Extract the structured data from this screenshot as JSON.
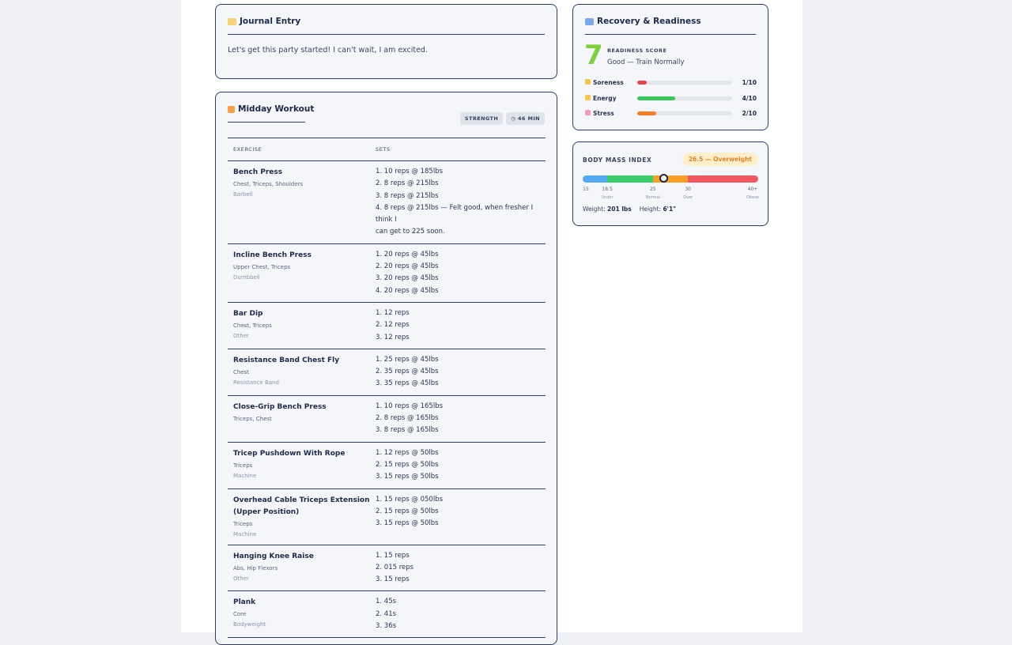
{
  "journal": {
    "title": "Journal Entry",
    "icon": "memo-icon",
    "text": "Let's get this party started! I can't wait, I am excited."
  },
  "workout": {
    "title": "Midday Workout",
    "icon": "weightlifter-icon",
    "type_chip": "STRENGTH",
    "duration_chip": "46 MIN",
    "columns": [
      "EXERCISE",
      "SETS"
    ],
    "exercises": [
      {
        "name": "Bench Press",
        "muscles": "Chest, Triceps, Shoulders",
        "equipment": "Barbell",
        "sets": [
          "1. 10 reps @ 185lbs",
          "2. 8 reps @ 215lbs",
          "3. 8 reps @ 215lbs",
          "4. 8 reps @ 215lbs — Felt good, when fresher I think I",
          "can get to 225 soon."
        ]
      },
      {
        "name": "Incline Bench Press",
        "muscles": "Upper Chest, Triceps",
        "equipment": "Dumbbell",
        "sets": [
          "1. 20 reps @ 45lbs",
          "2. 20 reps @ 45lbs",
          "3. 20 reps @ 45lbs",
          "4. 20 reps @ 45lbs"
        ]
      },
      {
        "name": "Bar Dip",
        "muscles": "Chest, Triceps",
        "equipment": "Other",
        "sets": [
          "1. 12 reps",
          "2. 12 reps",
          "3. 12 reps"
        ]
      },
      {
        "name": "Resistance Band Chest Fly",
        "muscles": "Chest",
        "equipment": "Resistance Band",
        "sets": [
          "1. 25 reps @ 45lbs",
          "2. 35 reps @ 45lbs",
          "3. 35 reps @ 45lbs"
        ]
      },
      {
        "name": "Close-Grip Bench Press",
        "muscles": "Triceps, Chest",
        "equipment": "",
        "sets": [
          "1. 10 reps @ 165lbs",
          "2. 8 reps @ 165lbs",
          "3. 8 reps @ 165lbs"
        ]
      },
      {
        "name": "Tricep Pushdown With Rope",
        "muscles": "Triceps",
        "equipment": "Machine",
        "sets": [
          "1. 12 reps @ 50lbs",
          "2. 15 reps @ 50lbs",
          "3. 15 reps @ 50lbs"
        ]
      },
      {
        "name": "Overhead Cable Triceps Extension (Upper Position)",
        "muscles": "Triceps",
        "equipment": "Machine",
        "sets": [
          "1. 15 reps @ 050lbs",
          "2. 15 reps @ 50lbs",
          "3. 15 reps @ 50lbs"
        ]
      },
      {
        "name": "Hanging Knee Raise",
        "muscles": "Abs, Hip Flexors",
        "equipment": "Other",
        "sets": [
          "1. 15 reps",
          "2. 015 reps",
          "3. 15 reps"
        ]
      },
      {
        "name": "Plank",
        "muscles": "Core",
        "equipment": "Bodyweight",
        "sets": [
          "1. 45s",
          "2. 41s",
          "3. 36s"
        ]
      }
    ]
  },
  "recovery": {
    "title": "Recovery & Readiness",
    "icon": "bed-icon",
    "score": "7",
    "score_label": "READINESS SCORE",
    "score_text": "Good — Train Normally",
    "score_color": "#7fd13b",
    "metrics": [
      {
        "name": "Soreness",
        "icon": "flexed-arm-icon",
        "value": "1/10",
        "level": 0.1,
        "color": "#e8454b"
      },
      {
        "name": "Energy",
        "icon": "lightning-icon",
        "value": "4/10",
        "level": 0.4,
        "color": "#34c759"
      },
      {
        "name": "Stress",
        "icon": "brain-icon",
        "value": "2/10",
        "level": 0.2,
        "color": "#f97c1e"
      }
    ]
  },
  "bmi": {
    "title": "BODY MASS INDEX",
    "badge": "26.5 — Overweight",
    "value": 26.5,
    "scale_min": 15,
    "scale_max": 40,
    "ticks": [
      {
        "value": 15,
        "label": "15",
        "sub": ""
      },
      {
        "value": 18.5,
        "label": "18.5",
        "sub": "Under"
      },
      {
        "value": 25,
        "label": "25",
        "sub": "Normal"
      },
      {
        "value": 30,
        "label": "30",
        "sub": "Over"
      },
      {
        "value": 40,
        "label": "40+",
        "sub": "Obese"
      }
    ],
    "segment_colors": [
      "#52a8f2",
      "#3bcc6b",
      "#f7a127",
      "#f0575e"
    ],
    "weight_label": "Weight:",
    "weight": "201 lbs",
    "height_label": "Height:",
    "height": "6'1\""
  }
}
